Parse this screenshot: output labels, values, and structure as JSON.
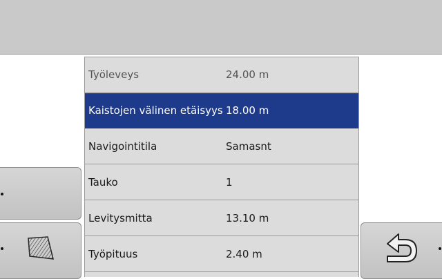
{
  "settings": {
    "rows": [
      {
        "label": "Työleveys",
        "value": "24.00 m",
        "state": "dim"
      },
      {
        "label": "Kaistojen välinen etäisyys",
        "value": "18.00 m",
        "state": "selected"
      },
      {
        "label": "Navigointitila",
        "value": "Samasnt",
        "state": "normal"
      },
      {
        "label": "Tauko",
        "value": "1",
        "state": "normal"
      },
      {
        "label": "Levitysmitta",
        "value": "13.10 m",
        "state": "normal"
      },
      {
        "label": "Työpituus",
        "value": "2.40 m",
        "state": "normal"
      }
    ]
  },
  "buttons": {
    "left_top": {
      "icon": "blank"
    },
    "left_bottom": {
      "icon": "field-boundary-icon"
    },
    "right_bottom": {
      "icon": "back-arrow-icon"
    }
  },
  "colors": {
    "selected_background": "#1e3a8a",
    "list_background": "#dcdcdc",
    "button_background": "#c9c9c9"
  }
}
